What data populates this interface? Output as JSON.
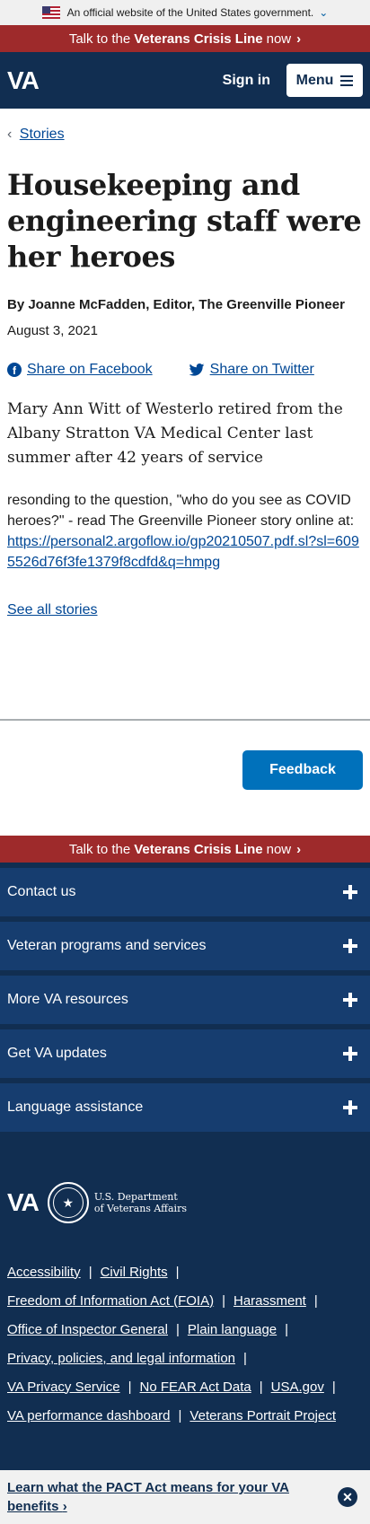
{
  "gov_banner": {
    "text": "An official website of the United States government.",
    "chevron": "chevron-down-icon"
  },
  "crisis_line": {
    "prefix": "Talk to the",
    "emphasis": "Veterans Crisis Line",
    "suffix": "now",
    "chevron": "›"
  },
  "header": {
    "logo": "VA",
    "sign_in": "Sign in",
    "menu": "Menu"
  },
  "breadcrumb": {
    "label": "Stories",
    "chevron": "‹"
  },
  "article": {
    "title": "Housekeeping and engineering staff were her heroes",
    "byline": "By Joanne McFadden, Editor, The Greenville Pioneer",
    "date": "August 3, 2021",
    "share_facebook": "Share on Facebook",
    "share_twitter": "Share on Twitter",
    "lede": "Mary Ann Witt of Westerlo retired from the Albany Stratton VA Medical Center last summer after 42 years of service",
    "body_prefix": "resonding to the question, \"who do you see as COVID heroes?\" - read The Greenville Pioneer story online at:",
    "body_link": "https://personal2.argoflow.io/gp20210507.pdf.sl?sl=6095526d76f3fe1379f8cdfd&q=hmpg",
    "see_all": "See all stories"
  },
  "feedback": {
    "label": "Feedback"
  },
  "footer": {
    "accordion": [
      {
        "label": "Contact us"
      },
      {
        "label": "Veteran programs and services"
      },
      {
        "label": "More VA resources"
      },
      {
        "label": "Get VA updates"
      },
      {
        "label": "Language assistance"
      }
    ],
    "logo": "VA",
    "dept_line1": "U.S. Department",
    "dept_line2": "of Veterans Affairs",
    "links": {
      "accessibility": "Accessibility",
      "civil_rights": "Civil Rights",
      "foia": "Freedom of Information Act (FOIA)",
      "harassment": "Harassment",
      "oig": "Office of Inspector General",
      "plain_language": "Plain language",
      "privacy": "Privacy, policies, and legal information",
      "privacy_service": "VA Privacy Service",
      "no_fear": "No FEAR Act Data",
      "usa_gov": "USA.gov",
      "performance": "VA performance dashboard",
      "portrait": "Veterans Portrait Project"
    },
    "separator": "|"
  },
  "pact_banner": {
    "text": "Learn what the PACT Act means for your VA benefits",
    "chevron": "›",
    "close_icon": "close-icon"
  },
  "colors": {
    "header_bg": "#112e51",
    "crisis_bg": "#9e2a2b",
    "accordion_bg": "#163d6f",
    "link": "#004795",
    "feedback_bg": "#0071bb"
  }
}
